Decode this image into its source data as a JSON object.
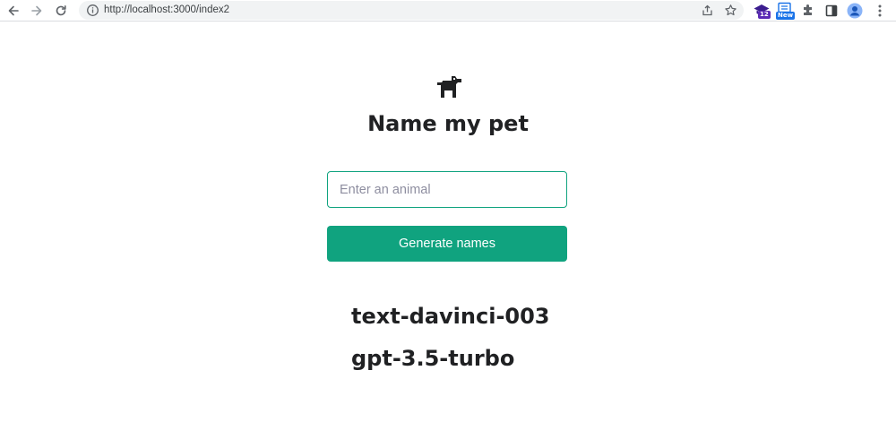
{
  "browser": {
    "url": "http://localhost:3000/index2",
    "extensions": [
      {
        "icon": "graduation-cap-extension-icon",
        "badge": "12",
        "badge_color": "#5b2bb5"
      },
      {
        "icon": "note-extension-icon",
        "badge": "New",
        "badge_color": "#1a73e8"
      }
    ]
  },
  "page": {
    "icon": "dog-icon",
    "title": "Name my pet",
    "input": {
      "placeholder": "Enter an animal",
      "value": ""
    },
    "generate_label": "Generate names",
    "models": [
      "text-davinci-003",
      "gpt-3.5-turbo"
    ]
  },
  "colors": {
    "accent": "#10a37f",
    "text": "#202123"
  }
}
